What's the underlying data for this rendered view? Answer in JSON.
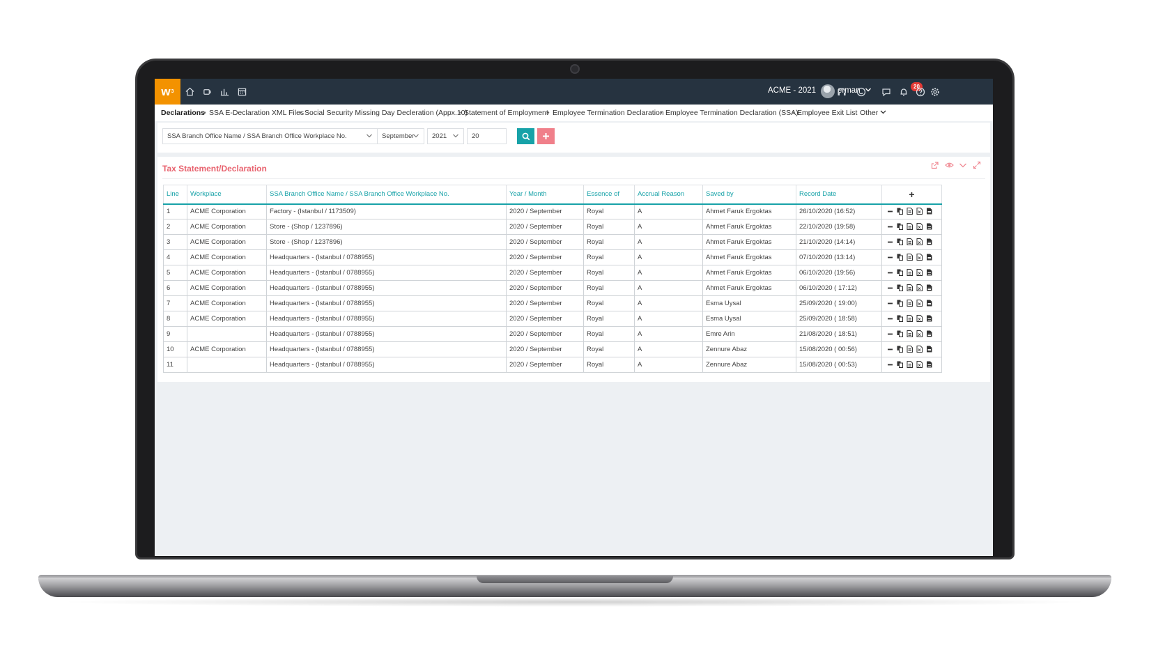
{
  "topbar": {
    "logo": "w",
    "logo_sup": "3",
    "company": "ACME - 2021",
    "username": "erman",
    "notification_count": "20",
    "nav_icons": [
      "home-icon",
      "coffee-icon",
      "chart-icon",
      "calendar-icon"
    ],
    "right_icons": [
      "headset-icon",
      "smile-icon",
      "chat-icon",
      "bell-icon",
      "help-icon",
      "gear-icon"
    ]
  },
  "subnav": {
    "items": [
      "Declarations",
      "SSA E-Declaration XML Files",
      "Social Security Missing Day Decleration (Appx.10)",
      "Statement of Employment",
      "Employee Termination Declaration",
      "Employee Termination Declaration (SSA)",
      "Employee Exit List"
    ],
    "other": "Other"
  },
  "filters": {
    "branch": "SSA Branch Office Name / SSA Branch Office Workplace No.",
    "month": "September",
    "year": "2021",
    "count": "20"
  },
  "panel": {
    "title": "Tax Statement/Declaration"
  },
  "table": {
    "headers": [
      "Line",
      "Workplace",
      "SSA Branch Office Name / SSA Branch Office Workplace No.",
      "Year / Month",
      "Essence of",
      "Accrual Reason",
      "Saved by",
      "Record Date",
      "+"
    ],
    "rows": [
      [
        "1",
        "ACME Corporation",
        "Factory - (Istanbul / 1173509)",
        "2020 / September",
        "Royal",
        "A",
        "Ahmet Faruk Ergoktas",
        "26/10/2020 (16:52)"
      ],
      [
        "2",
        "ACME Corporation",
        "Store - (Shop / 1237896)",
        "2020 / September",
        "Royal",
        "A",
        "Ahmet Faruk Ergoktas",
        "22/10/2020 (19:58)"
      ],
      [
        "3",
        "ACME Corporation",
        "Store - (Shop / 1237896)",
        "2020 / September",
        "Royal",
        "A",
        "Ahmet Faruk Ergoktas",
        "21/10/2020 (14:14)"
      ],
      [
        "4",
        "ACME Corporation",
        "Headquarters - (Istanbul / 0788955)",
        "2020 / September",
        "Royal",
        "A",
        "Ahmet Faruk Ergoktas",
        "07/10/2020 (13:14)"
      ],
      [
        "5",
        "ACME Corporation",
        "Headquarters - (Istanbul / 0788955)",
        "2020 / September",
        "Royal",
        "A",
        "Ahmet Faruk Ergoktas",
        "06/10/2020 (19:56)"
      ],
      [
        "6",
        "ACME Corporation",
        "Headquarters - (Istanbul / 0788955)",
        "2020 / September",
        "Royal",
        "A",
        "Ahmet Faruk Ergoktas",
        "06/10/2020 ( 17:12)"
      ],
      [
        "7",
        "ACME Corporation",
        "Headquarters - (Istanbul / 0788955)",
        "2020 / September",
        "Royal",
        "A",
        "Esma Uysal",
        "25/09/2020 ( 19:00)"
      ],
      [
        "8",
        "ACME Corporation",
        "Headquarters - (Istanbul / 0788955)",
        "2020 / September",
        "Royal",
        "A",
        "Esma Uysal",
        "25/09/2020 ( 18:58)"
      ],
      [
        "9",
        "",
        "Headquarters - (Istanbul / 0788955)",
        "2020 / September",
        "Royal",
        "A",
        "Emre Arin",
        "21/08/2020 ( 18:51)"
      ],
      [
        "10",
        "ACME Corporation",
        "Headquarters - (Istanbul / 0788955)",
        "2020 / September",
        "Royal",
        "A",
        "Zennure Abaz",
        "15/08/2020 ( 00:56)"
      ],
      [
        "11",
        "",
        "Headquarters - (Istanbul / 0788955)",
        "2020 / September",
        "Royal",
        "A",
        "Zennure Abaz",
        "15/08/2020 ( 00:53)"
      ]
    ],
    "row_actions": [
      "minus-icon",
      "copy-icon",
      "document-icon",
      "excel-icon",
      "file-icon"
    ]
  },
  "colors": {
    "topbar": "#263340",
    "logo": "#f39200",
    "accent": "#17a2a8",
    "danger": "#f07f8a",
    "title": "#e8636f"
  }
}
